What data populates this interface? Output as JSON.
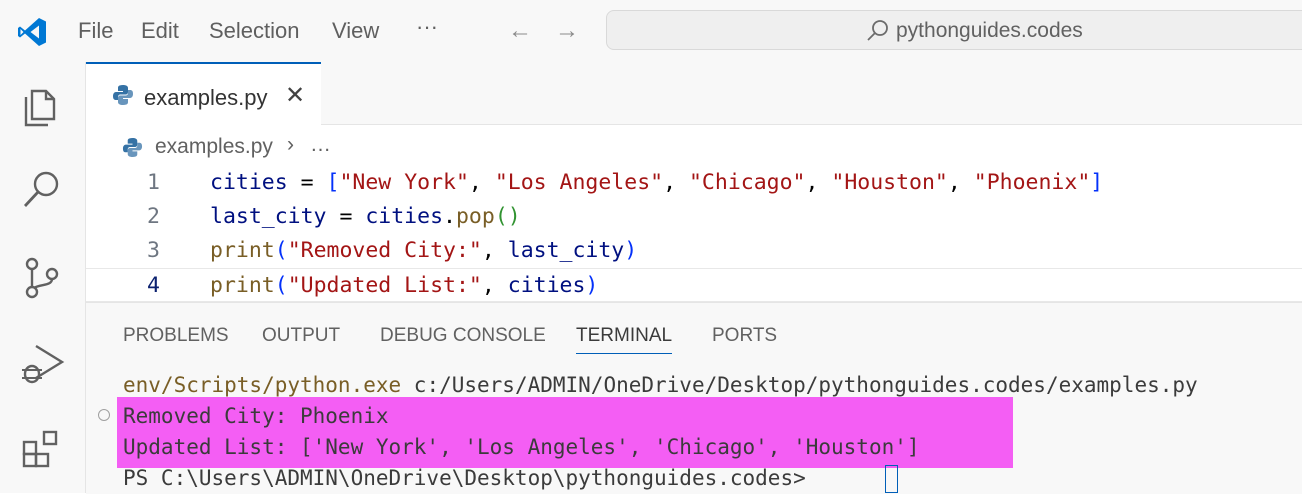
{
  "titlebar": {
    "menu": [
      "File",
      "Edit",
      "Selection",
      "View"
    ],
    "more": "···",
    "back_arrow": "←",
    "forward_arrow": "→",
    "search_text": "pythonguides.codes"
  },
  "tab": {
    "label": "examples.py",
    "close": "✕"
  },
  "breadcrumb": {
    "file": "examples.py",
    "separator": "›",
    "more": "…"
  },
  "editor": {
    "line_numbers": [
      "1",
      "2",
      "3",
      "4"
    ],
    "current_line": 4
  },
  "panel": {
    "tabs": [
      "PROBLEMS",
      "OUTPUT",
      "DEBUG CONSOLE",
      "TERMINAL",
      "PORTS"
    ],
    "active_tab": "TERMINAL"
  },
  "terminal": {
    "line1_prefix": "env/Scripts/python.exe",
    "line1_rest": " c:/Users/ADMIN/OneDrive/Desktop/pythonguides.codes/examples.py",
    "line2": "Removed City: Phoenix",
    "line3": "Updated List: ['New York', 'Los Angeles', 'Chicago', 'Houston']",
    "line4": "PS C:\\Users\\ADMIN\\OneDrive\\Desktop\\pythonguides.codes> "
  },
  "colors": {
    "accent": "#005fb8",
    "highlight": "#f45ef4",
    "string": "#a31515",
    "variable": "#001080",
    "function": "#795e26"
  }
}
